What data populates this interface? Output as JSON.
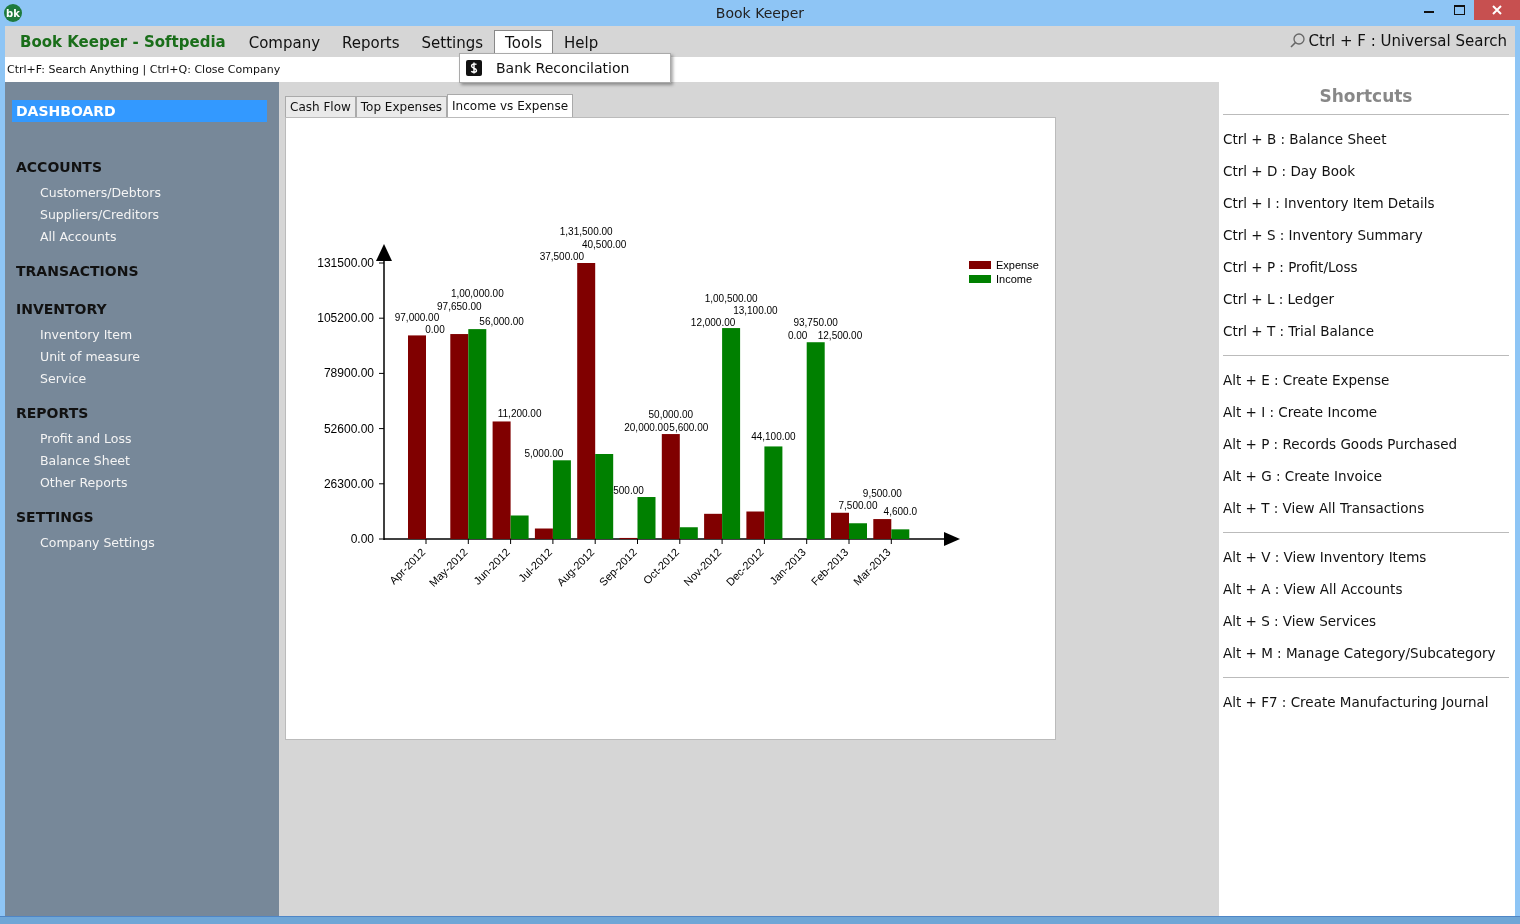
{
  "window": {
    "title": "Book Keeper",
    "icon_text": "bk"
  },
  "menu_bar": {
    "brand": "Book Keeper - Softpedia",
    "items": [
      {
        "label": "Company",
        "selected": false
      },
      {
        "label": "Reports",
        "selected": false
      },
      {
        "label": "Settings",
        "selected": false
      },
      {
        "label": "Tools",
        "selected": true
      },
      {
        "label": "Help",
        "selected": false
      }
    ],
    "search_hint": "Ctrl + F  : Universal Search"
  },
  "dropdown": {
    "items": [
      "Bank Reconcilation"
    ]
  },
  "hint_bar": "Ctrl+F: Search Anything | Ctrl+Q: Close Company",
  "sidebar": {
    "sections": [
      {
        "label": "DASHBOARD",
        "selected": true
      },
      {
        "label": "ACCOUNTS",
        "selected": false,
        "children": [
          {
            "label": "Customers/Debtors",
            "selected": false
          },
          {
            "label": "Suppliers/Creditors",
            "selected": false
          },
          {
            "label": "All Accounts",
            "selected": false
          }
        ]
      },
      {
        "label": "TRANSACTIONS",
        "selected": false
      },
      {
        "label": "INVENTORY",
        "selected": false,
        "children": [
          {
            "label": "Inventory Item",
            "selected": false
          },
          {
            "label": "Unit of measure",
            "selected": false
          },
          {
            "label": "Service",
            "selected": false
          }
        ]
      },
      {
        "label": "REPORTS",
        "selected": false,
        "children": [
          {
            "label": "Profit and Loss",
            "selected": false
          },
          {
            "label": "Balance Sheet",
            "selected": false
          },
          {
            "label": "Other Reports",
            "selected": false
          }
        ]
      },
      {
        "label": "SETTINGS",
        "selected": false,
        "children": [
          {
            "label": "Company Settings",
            "selected": false
          }
        ]
      }
    ]
  },
  "tabs": [
    {
      "label": "Cash Flow",
      "selected": false
    },
    {
      "label": "Top Expenses",
      "selected": false
    },
    {
      "label": "Income vs Expense",
      "selected": true
    }
  ],
  "chart_data": {
    "type": "bar",
    "categories": [
      "Apr-2012",
      "May-2012",
      "Jun-2012",
      "Jul-2012",
      "Aug-2012",
      "Sep-2012",
      "Oct-2012",
      "Nov-2012",
      "Dec-2012",
      "Jan-2013",
      "Feb-2013",
      "Mar-2013"
    ],
    "series": [
      {
        "name": "Expense",
        "color": "#800000",
        "values": [
          97000,
          97650,
          56000,
          5000,
          131500,
          500,
          50000,
          12000,
          13100,
          0,
          12500,
          9500
        ]
      },
      {
        "name": "Income",
        "color": "#008000",
        "values": [
          0,
          100000,
          11200,
          37500,
          40500,
          20000,
          5600,
          100500,
          44100,
          93750,
          7500,
          4600
        ]
      }
    ],
    "ylim": [
      0,
      131500
    ],
    "yticks": [
      {
        "value": 0,
        "label": "0.00"
      },
      {
        "value": 26300,
        "label": "26300.00"
      },
      {
        "value": 52600,
        "label": "52600.00"
      },
      {
        "value": 78900,
        "label": "78900.00"
      },
      {
        "value": 105200,
        "label": "105200.00"
      },
      {
        "value": 131500,
        "label": "131500.00"
      }
    ],
    "value_labels": [
      [
        "97,000.00",
        "97,650.00",
        "56,000.00",
        "5,000.00",
        "1,31,500.00",
        "500.00",
        "50,000.00",
        "12,000.00",
        "13,100.00",
        "0.00",
        "12,500.00",
        "9,500.00"
      ],
      [
        "0.00",
        "1,00,000.00",
        "11,200.00",
        "37,500.00",
        "40,500.00",
        "20,000.00",
        "5,600.00",
        "1,00,500.00",
        "44,100.00",
        "93,750.00",
        "7,500.00",
        "4,600.0"
      ]
    ],
    "legend": true
  },
  "shortcuts": {
    "title": "Shortcuts",
    "groups": [
      [
        "Ctrl + B : Balance Sheet",
        "Ctrl + D : Day Book",
        "Ctrl + I  : Inventory Item Details",
        "Ctrl + S : Inventory Summary",
        "Ctrl + P : Profit/Loss",
        "Ctrl + L : Ledger",
        "Ctrl + T : Trial Balance"
      ],
      [
        "Alt + E : Create Expense",
        "Alt + I  : Create Income",
        "Alt + P : Records Goods Purchased",
        "Alt + G : Create Invoice",
        "Alt + T : View All Transactions"
      ],
      [
        "Alt + V : View Inventory Items",
        "Alt + A : View All Accounts",
        "Alt + S : View Services",
        "Alt + M : Manage Category/Subcategory"
      ],
      [
        "Alt + F7 : Create Manufacturing Journal"
      ]
    ]
  }
}
